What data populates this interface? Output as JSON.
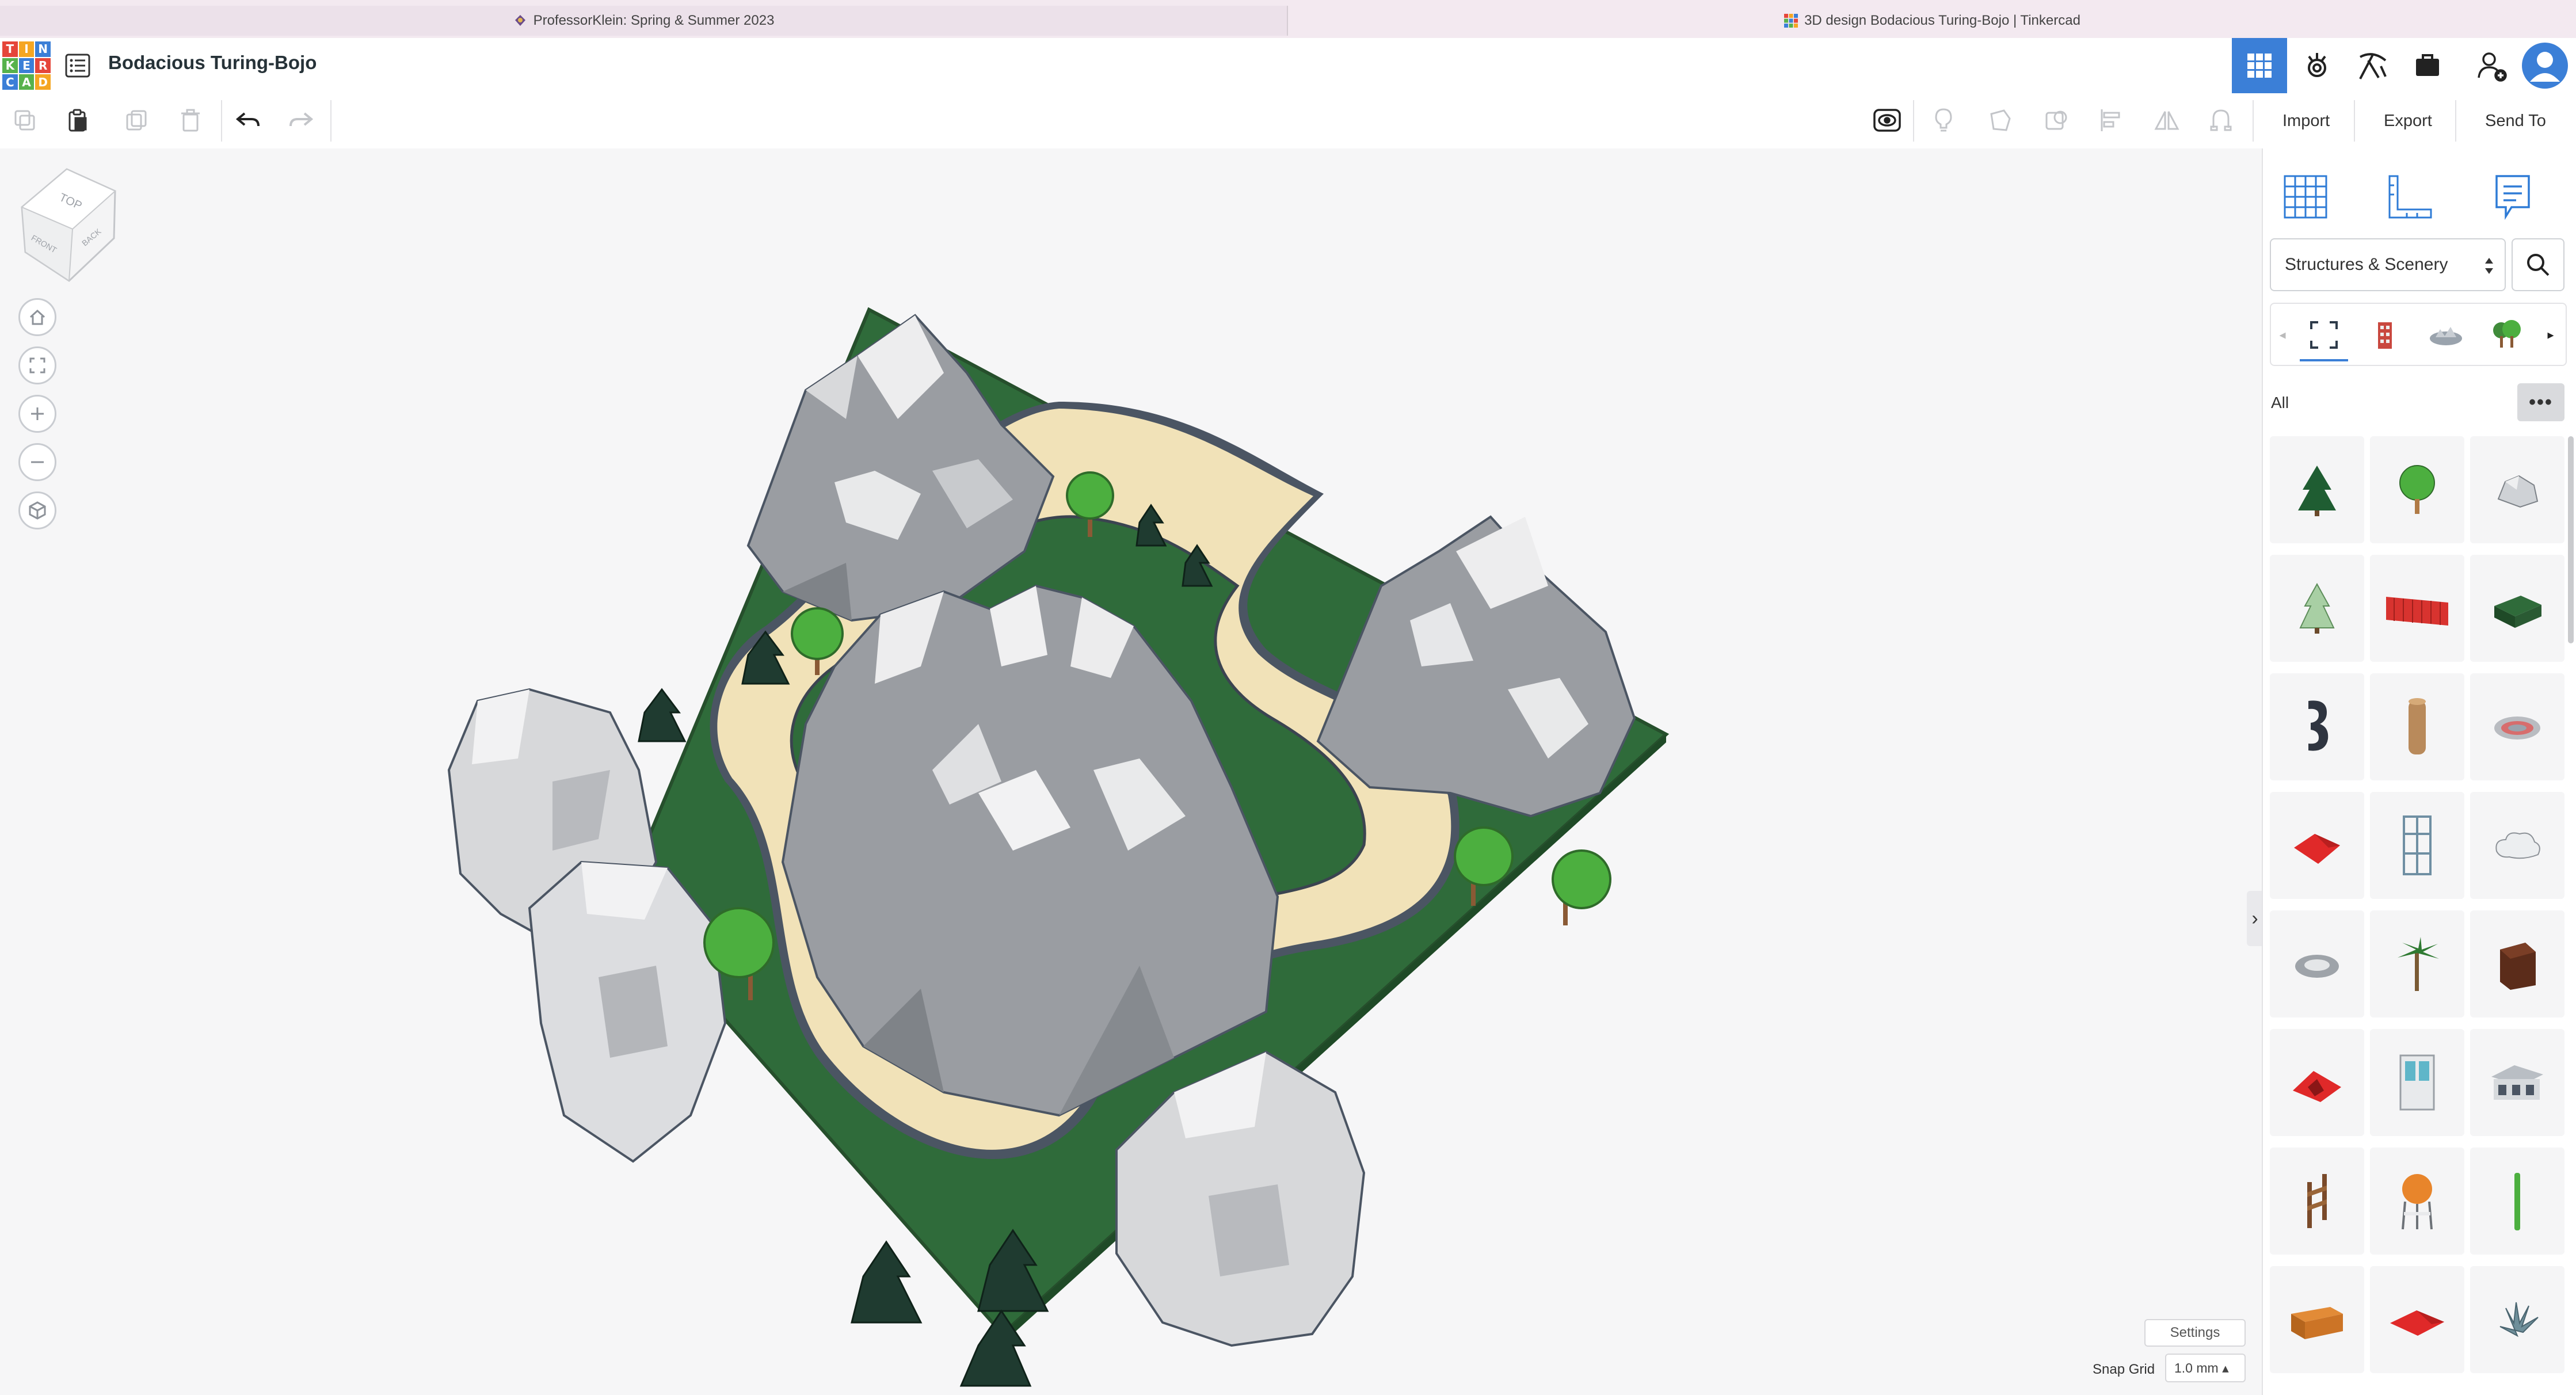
{
  "browser": {
    "tab1_title": "ProfessorKlein: Spring & Summer 2023",
    "tab2_title": "3D design Bodacious Turing-Bojo | Tinkercad"
  },
  "header": {
    "logo_letters": [
      "T",
      "I",
      "N",
      "K",
      "E",
      "R",
      "C",
      "A",
      "D"
    ],
    "design_title": "Bodacious Turing-Bojo",
    "icons": [
      "3d-design-icon",
      "circuits-icon",
      "codeblocks-icon",
      "projects-icon",
      "invite-user-icon",
      "account-avatar-icon"
    ]
  },
  "toolbar": {
    "import_label": "Import",
    "export_label": "Export",
    "send_to_label": "Send To"
  },
  "workplane": {
    "viewcube_labels": {
      "top": "TOP",
      "front": "FRONT",
      "back": "BACK"
    },
    "settings_label": "Settings",
    "snap_grid_label": "Snap Grid",
    "snap_grid_value": "1.0 mm ▴"
  },
  "panel": {
    "category_value": "Structures & Scenery",
    "filter_label": "All",
    "more_label": "•••",
    "shapes": [
      "pine-tree",
      "round-tree",
      "rock",
      "snowy-pine",
      "red-fence",
      "grass-block",
      "number-three",
      "wood-log",
      "pond",
      "red-roof",
      "window-frame",
      "cloud",
      "stone-ring",
      "palm-tree",
      "wood-box",
      "red-tent",
      "window",
      "cottage",
      "wood-fence",
      "water-tower",
      "green-post",
      "wood-crate",
      "red-roof-small",
      "shrub"
    ]
  },
  "colors": {
    "accent": "#3b7fd7",
    "ground": "#2f6b3a",
    "path": "#f1e2b8",
    "rock": "#9a9da2"
  }
}
